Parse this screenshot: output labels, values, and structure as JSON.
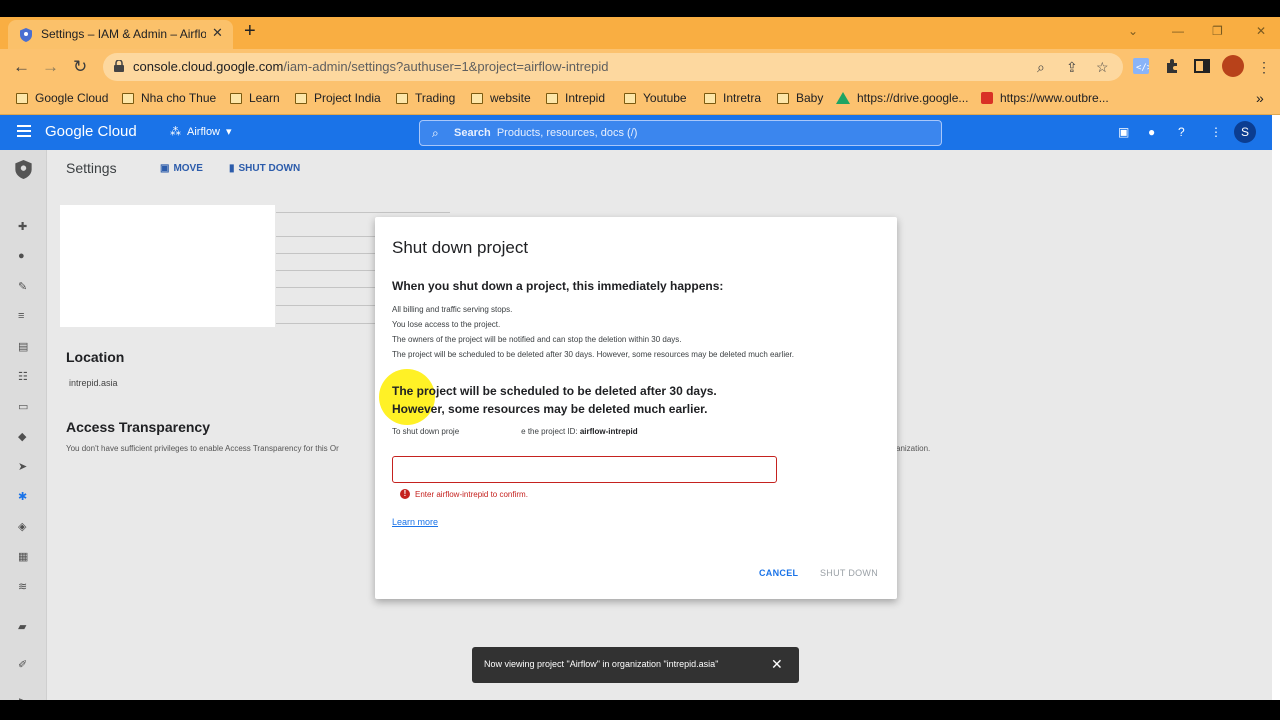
{
  "browser": {
    "tab_title": "Settings – IAM & Admin – Airflow",
    "tab_close": "✕",
    "new_tab": "+",
    "window_controls": [
      "⌄",
      "—",
      "❐",
      "✕"
    ],
    "url_host": "console.cloud.google.com",
    "url_path": "/iam-admin/settings?authuser=1&project=airflow-intrepid"
  },
  "bookmarks": [
    {
      "label": "Google Cloud",
      "icon": "folder"
    },
    {
      "label": "Nha cho Thue",
      "icon": "folder"
    },
    {
      "label": "Learn",
      "icon": "folder"
    },
    {
      "label": "Project India",
      "icon": "folder"
    },
    {
      "label": "Trading",
      "icon": "folder"
    },
    {
      "label": "website",
      "icon": "folder"
    },
    {
      "label": "Intrepid",
      "icon": "folder"
    },
    {
      "label": "Youtube",
      "icon": "folder"
    },
    {
      "label": "Intretra",
      "icon": "folder"
    },
    {
      "label": "Baby",
      "icon": "folder"
    },
    {
      "label": "https://drive.google...",
      "icon": "google-drive"
    },
    {
      "label": "https://www.outbre...",
      "icon": "red-site"
    }
  ],
  "gcp": {
    "logo": "Google Cloud",
    "project": "Airflow",
    "search_label": "Search",
    "search_placeholder": "Products, resources, docs (/)",
    "avatar_initial": "S"
  },
  "page": {
    "title": "Settings",
    "move_label": "MOVE",
    "shutdown_label": "SHUT DOWN",
    "location_heading": "Location",
    "organization": "intrepid.asia",
    "access_heading": "Access Transparency",
    "access_text": "You don't have sufficient privileges to enable Access Transparency for this Or",
    "access_text_tail": "anization."
  },
  "dialog": {
    "title": "Shut down project",
    "subtitle": "When you shut down a project, this immediately happens:",
    "lines": [
      "All billing and traffic serving stops.",
      "You lose access to the project.",
      "The owners of the project will be notified and can stop the deletion within 30 days.",
      "The project will be scheduled to be deleted after 30 days. However, some resources may be deleted much earlier."
    ],
    "big_line_1": "The project will be scheduled to be deleted after 30 days.",
    "big_line_2": "However, some resources may be deleted much earlier.",
    "confirm_prefix": "To shut down proje",
    "confirm_mid": "e the project ID: ",
    "project_id": "airflow-intrepid",
    "error_text": "Enter airflow-intrepid to confirm.",
    "learn_more": "Learn more",
    "cancel": "CANCEL",
    "shut_down": "SHUT DOWN"
  },
  "snackbar": {
    "text": "Now viewing project \"Airflow\" in organization \"intrepid.asia\"",
    "close": "✕"
  },
  "colors": {
    "chrome_accent": "#f9ae42",
    "gcp_blue": "#1a73e8",
    "error_red": "#c5221f"
  }
}
